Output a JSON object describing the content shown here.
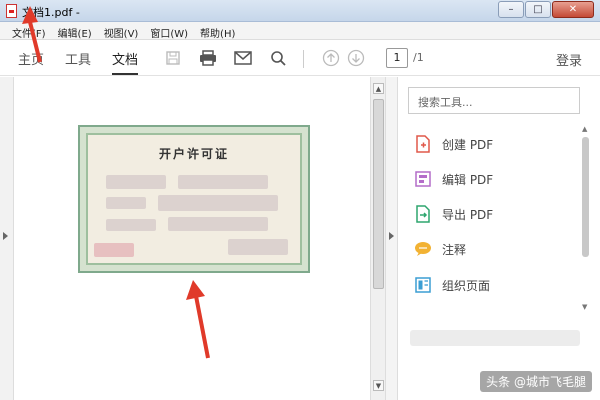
{
  "window": {
    "title": "文档1.pdf -",
    "min_label": "–",
    "max_label": "□",
    "close_label": "✕"
  },
  "menu": {
    "items": [
      "文件(F)",
      "编辑(E)",
      "视图(V)",
      "窗口(W)",
      "帮助(H)"
    ]
  },
  "toolbar": {
    "tabs": [
      "主页",
      "工具",
      "文档"
    ],
    "active_tab": "文档",
    "icons": [
      "save-icon",
      "print-icon",
      "mail-icon",
      "search-icon",
      "up-icon",
      "down-icon"
    ],
    "page_current": "1",
    "page_total": "/1",
    "login": "登录"
  },
  "document": {
    "cert_title": "开户许可证"
  },
  "right_panel": {
    "search_placeholder": "搜索工具...",
    "tools": [
      {
        "label": "创建 PDF",
        "icon": "create-pdf-icon",
        "color": "#e0584a"
      },
      {
        "label": "编辑 PDF",
        "icon": "edit-pdf-icon",
        "color": "#b46dc9"
      },
      {
        "label": "导出 PDF",
        "icon": "export-pdf-icon",
        "color": "#2fa56f"
      },
      {
        "label": "注释",
        "icon": "comment-icon",
        "color": "#f2b233"
      },
      {
        "label": "组织页面",
        "icon": "organize-pages-icon",
        "color": "#3b9ed3"
      }
    ]
  },
  "watermark": "头条 @城市飞毛腿",
  "colors": {
    "annotation_arrow": "#e03a2a",
    "certificate_border": "#7fa98c"
  }
}
